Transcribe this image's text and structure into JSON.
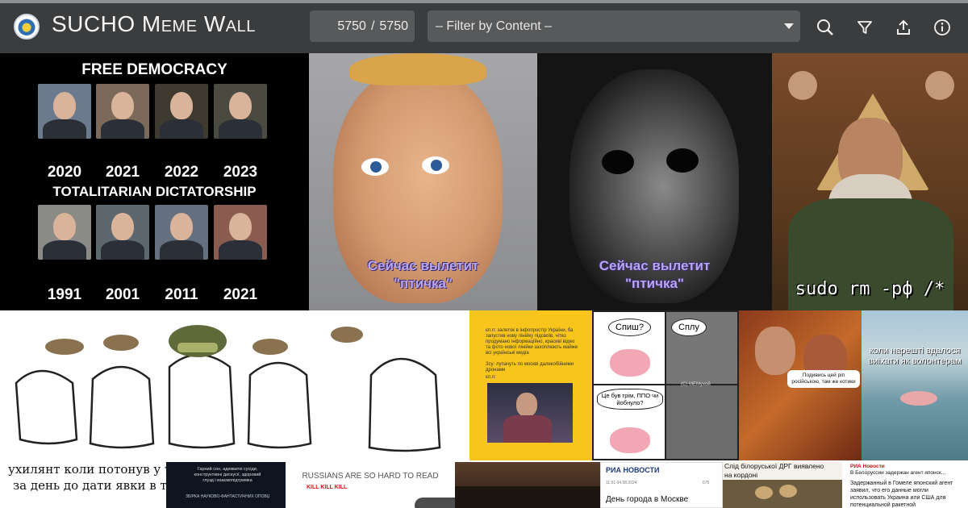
{
  "header": {
    "logo_icon": "sucho-logo-icon",
    "title": "SUCHO Meme Wall",
    "counter": {
      "current": "5750",
      "separator": "/",
      "total": "5750"
    },
    "filter": {
      "selected": "– Filter by Content –"
    },
    "tools": [
      "search-icon",
      "filter-icon",
      "share-icon",
      "info-icon"
    ]
  },
  "memes": {
    "democracy": {
      "top_caption": "FREE DEMOCRACY",
      "years_top": [
        "2020",
        "2021",
        "2022",
        "2023"
      ],
      "middle_caption": "TOTALITARIAN DICTATORSHIP",
      "years_bottom": [
        "1991",
        "2001",
        "2011",
        "2021"
      ]
    },
    "incredible_light": {
      "caption_line1": "Сейчас вылетит",
      "caption_line2": "\"птичка\""
    },
    "incredible_dark": {
      "caption_line1": "Сейчас вылетит",
      "caption_line2": "\"птичка\""
    },
    "icon": {
      "caption": "sudo rm -рф /*"
    },
    "flork": {
      "caption_line1": "ухилянт коли потонув у тисі",
      "caption_line2": "за день до дати явки в тцк"
    },
    "yellow_post": {
      "text1": "єп.п: залеток в інфопростір України, ба запустив нову лінійку підсвоїв, чітко продумано інформаційно, красиві відео та фото нової лінійки захоплюють майже всі українські медіа",
      "text2": "Зсу: лупачуть по москві далекобійними дронами",
      "text3": "єп.п:"
    },
    "brain": {
      "q1": "Спиш?",
      "a1": "Сплу",
      "q2": "Це був грім, ППО чи йобнуло?",
      "credit": "(С) МЕМухой"
    },
    "jesus_devil": {
      "bubble": "Подивись цей ріп російською, там же котики"
    },
    "boat": {
      "caption": "коли нарешті вдалося виїхати як волонтерам"
    },
    "night_sky": {
      "text": "Гарний сон, адекватні сусіди, конструктивні дискусії, здоровий глузд і взаємопідтримка",
      "badge": "ЗБІРКА НАУКОВО-ФАНТАСТИЧНИХ ОПОВІДАНЬ"
    },
    "russians": {
      "title": "RUSSIANS ARE SO HARD TO READ",
      "red_text": "KILL KILL KILL"
    },
    "ria": {
      "brand": "РИА НОВОСТИ",
      "meta_date": "11:51 04.08.2024",
      "meta_count": "675",
      "headline": "День города в Москве"
    },
    "potatoes": {
      "caption_line1": "Слід білоруської ДРГ виявлено",
      "caption_line2": "на кордоні"
    },
    "ria_belarus": {
      "brand": "РИА Новости",
      "line1": "В Белоруссии задержан агент японск...",
      "body": "Задержанный в Гомеле японский агент заявил, что его данные могли использовать Украина или США для потенциальной ракетной"
    }
  }
}
